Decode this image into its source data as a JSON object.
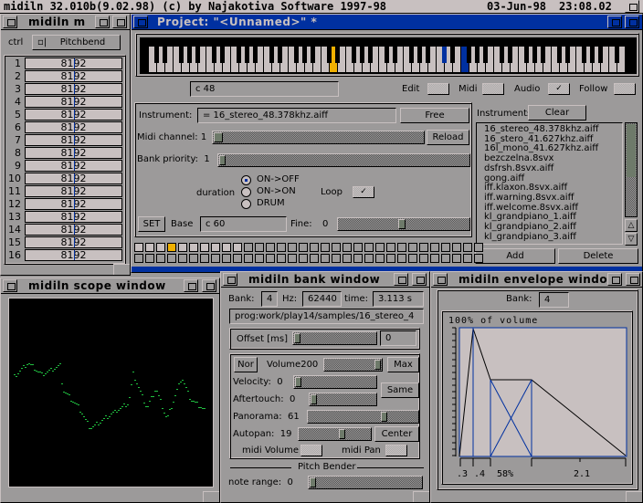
{
  "screen": {
    "title": "midiln 32.010b(9.02.98)  (c) by Najakotiva Software 1997-98",
    "date": "03-Jun-98",
    "time": "23:08.02"
  },
  "midi_window": {
    "title": "midiln m",
    "ctrl_label": "ctrl",
    "ctrl_value": "Pitchbend",
    "rows": [
      {
        "n": "1",
        "v": "8192"
      },
      {
        "n": "2",
        "v": "8192"
      },
      {
        "n": "3",
        "v": "8192"
      },
      {
        "n": "4",
        "v": "8192"
      },
      {
        "n": "5",
        "v": "8192"
      },
      {
        "n": "6",
        "v": "8192"
      },
      {
        "n": "7",
        "v": "8192"
      },
      {
        "n": "8",
        "v": "8192"
      },
      {
        "n": "9",
        "v": "8192"
      },
      {
        "n": "10",
        "v": "8192"
      },
      {
        "n": "11",
        "v": "8192"
      },
      {
        "n": "12",
        "v": "8192"
      },
      {
        "n": "13",
        "v": "8192"
      },
      {
        "n": "14",
        "v": "8192"
      },
      {
        "n": "15",
        "v": "8192"
      },
      {
        "n": "16",
        "v": "8192"
      }
    ]
  },
  "project": {
    "title": "Project: \"<Unnamed>\" *",
    "note": "c  48",
    "edit_label": "Edit",
    "midi_label": "Midi",
    "audio_label": "Audio",
    "follow_label": "Follow",
    "audio_checked": true,
    "edit_checked": false,
    "midi_checked": false,
    "follow_checked": false,
    "instrument_label": "Instrument:",
    "instrument_value": "= 16_stereo_48.378khz.aiff",
    "free_label": "Free",
    "midi_channel_label": "Midi channel:",
    "midi_channel_value": "1",
    "reload_label": "Reload",
    "bank_priority_label": "Bank priority:",
    "bank_priority_value": "1",
    "duration_label": "duration",
    "duration_options": [
      "ON->OFF",
      "ON->ON",
      "DRUM"
    ],
    "duration_selected": "ON->OFF",
    "loop_label": "Loop",
    "loop_checked": true,
    "set_label": "SET",
    "base_label": "Base",
    "base_value": "c  60",
    "fine_label": "Fine:",
    "fine_value": "0",
    "instruments_label": "Instruments:",
    "clear_label": "Clear",
    "instruments": [
      "16_stereo_48.378khz.aiff",
      "16_stero_41.627khz.aiff",
      "16l_mono_41.627khz.aiff",
      "bezczelna.8svx",
      "dsfrsh.8svx.aiff",
      "gong.aiff",
      "iff.klaxon.8svx.aiff",
      "iff.warning.8svx.aiff",
      "iff.welcome.8svx.aiff",
      "kl_grandpiano_1.aiff",
      "kl_grandpiano_2.aiff",
      "kl_grandpiano_3.aiff"
    ],
    "add_label": "Add",
    "delete_label": "Delete",
    "bank_slots_selected": 4,
    "colors": {
      "active_title": "#0030a0",
      "selected_slot": "#f0b000",
      "key_highlight_yellow": "#f0b000",
      "key_highlight_blue": "#0030a0"
    }
  },
  "scope": {
    "title": "midiln scope window",
    "trace_color": "#20c040"
  },
  "bank": {
    "title": "midiln bank window",
    "bank_label": "Bank:",
    "bank_value": "4",
    "hz_label": "Hz:",
    "hz_value": "62440",
    "time_label": "time:",
    "time_value": "3.113 s",
    "path": "prog:work/play14/samples/16_stereo_4",
    "offset_label": "Offset [ms]",
    "offset_value": "0",
    "nor_label": "Nor",
    "volume_label": "Volume",
    "volume_value": "200",
    "max_label": "Max",
    "velocity_label": "Velocity:",
    "velocity_value": "0",
    "same_label": "Same",
    "aftertouch_label": "Aftertouch:",
    "aftertouch_value": "0",
    "panorama_label": "Panorama:",
    "panorama_value": "61",
    "autopan_label": "Autopan:",
    "autopan_value": "19",
    "center_label": "Center",
    "midi_volume_label": "midi Volume",
    "midi_pan_label": "midi Pan",
    "pitch_bender_label": "Pitch Bender",
    "note_range_label": "note range:",
    "note_range_value": "0"
  },
  "envelope": {
    "title": "midiln envelope windo",
    "bank_label": "Bank:",
    "bank_value": "4",
    "heading": "100% of volume",
    "labels": [
      ".3",
      ".4",
      "58%",
      "2.1"
    ]
  }
}
